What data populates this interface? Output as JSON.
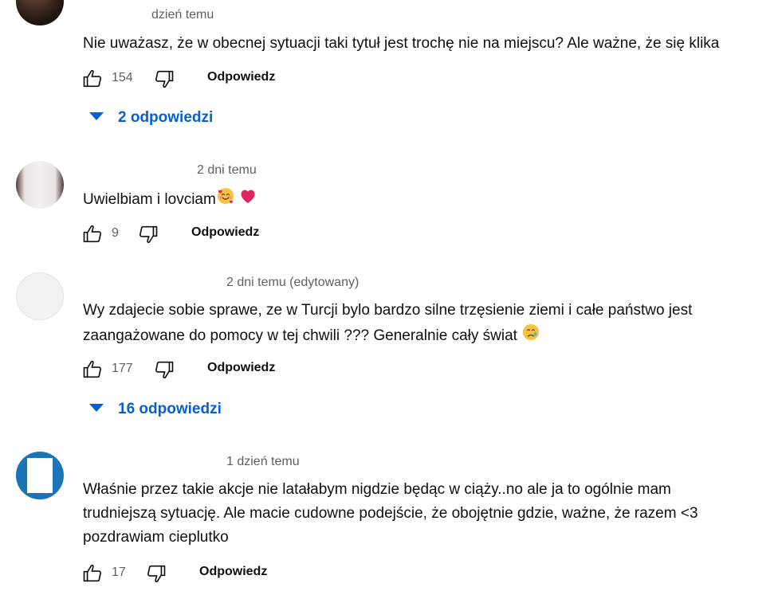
{
  "comments": [
    {
      "meta": "dzień temu",
      "lines": [
        "Nie uważasz, że w obecnej sytuacji taki tytuł jest trochę nie na miejscu? Ale ważne, że się klika"
      ],
      "likes": "154",
      "reply_label": "Odpowiedz",
      "replies_label": "2 odpowiedzi"
    },
    {
      "meta": "2 dni temu",
      "lines": [
        "Uwielbiam i lovciam"
      ],
      "emoji": [
        "smiling-face-with-hearts",
        "red-heart"
      ],
      "likes": "9",
      "reply_label": "Odpowiedz"
    },
    {
      "meta": "2 dni temu (edytowany)",
      "lines": [
        "Wy zdajecie sobie sprawe, ze w Turcji bylo bardzo silne trzęsienie ziemi i całe państwo jest",
        "zaangażowane do pomocy w tej chwili ??? Generalnie cały świat"
      ],
      "emoji": [
        "crying-face"
      ],
      "likes": "177",
      "reply_label": "Odpowiedz",
      "replies_label": "16 odpowiedzi"
    },
    {
      "meta": "1 dzień temu",
      "lines": [
        "Właśnie przez takie akcje nie latałabym nigdzie będąc w ciąży..no ale ja to ogólnie mam",
        "trudniejszą sytuację. Ale macie cudowne podejście, że obojętnie gdzie, ważne, że razem <3",
        "pozdrawiam cieplutko"
      ],
      "likes": "17",
      "reply_label": "Odpowiedz"
    }
  ],
  "colors": {
    "link": "#065fd4",
    "meta": "#606060",
    "text": "#0f0f0f"
  },
  "icons": [
    "thumb-up-icon",
    "thumb-down-icon",
    "chevron-down-icon"
  ]
}
